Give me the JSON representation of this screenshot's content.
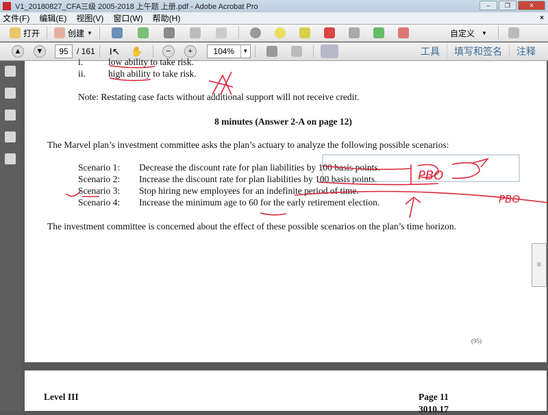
{
  "window": {
    "title": "V1_20180827_CFA三级 2005-2018 上午题  上册.pdf - Adobe Acrobat Pro",
    "minimize": "–",
    "restore": "❐",
    "close": "✕"
  },
  "menu": [
    "文件(F)",
    "编辑(E)",
    "视图(V)",
    "窗口(W)",
    "帮助(H)"
  ],
  "menu_close": "×",
  "toolbar": {
    "open": "打开",
    "create": "创建",
    "customize": "自定义"
  },
  "nav": {
    "page": "95",
    "total": "/ 161",
    "zoom": "104%"
  },
  "right_tabs": [
    "工具",
    "填写和签名",
    "注释"
  ],
  "doc": {
    "item_i_num": "i.",
    "item_i": "low ability to take risk.",
    "item_ii_num": "ii.",
    "item_ii": "high ability to take risk.",
    "note": "Note:  Restating case facts without additional support will not receive credit.",
    "heading": "8 minutes (Answer 2-A on page 12)",
    "intro": "The Marvel plan’s investment committee asks the plan’s actuary to analyze the following possible scenarios:",
    "scenarios": [
      {
        "label": "Scenario 1:",
        "text": "Decrease the discount rate for plan liabilities by 100 basis points."
      },
      {
        "label": "Scenario 2:",
        "text": "Increase the discount rate for plan liabilities by 100 basis points."
      },
      {
        "label": "Scenario 3:",
        "text": "Stop hiring new employees for an indefinite period of time."
      },
      {
        "label": "Scenario 4:",
        "text": "Increase the minimum age to 60 for the early retirement election."
      }
    ],
    "concern": "The investment committee is concerned about the effect of these possible scenarios on the plan’s time horizon.",
    "page_marker": "(95)",
    "next_level": "Level III",
    "next_page": "Page 11",
    "next_code": "3010.17"
  },
  "annotations": {
    "pbo1": "PBO",
    "pbo2": "PBO"
  },
  "colors": {
    "ink": "#d8283a",
    "title": "#c8d6e6"
  }
}
